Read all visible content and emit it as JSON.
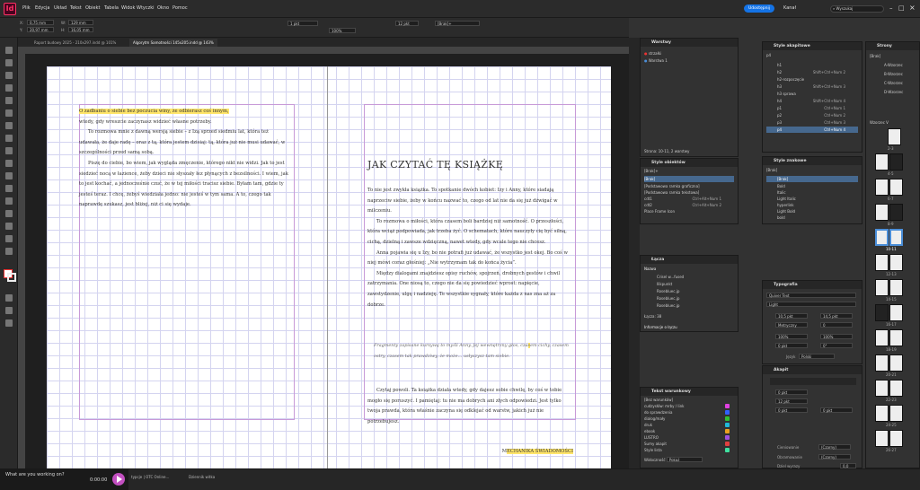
{
  "app": {
    "logo": "Id",
    "menu": [
      "Plik",
      "Edycja",
      "Układ",
      "Tekst",
      "Obiekt",
      "Tabela",
      "Widok",
      "Wtyczki",
      "Okno",
      "Pomoc"
    ],
    "share_button": "Udostępnij",
    "search_placeholder": "Wyszukaj"
  },
  "control": {
    "x": "0,75 mm",
    "y": "20,97 mm",
    "w": "129 mm",
    "h": "16,05 mm",
    "stroke_weight": "1 pkt",
    "zoom": "100%",
    "ref_pt": "12 pkt",
    "style": "[Brak]+"
  },
  "doc_tabs": [
    "Raport budowy 2025 - 210x297.indd @ 101%",
    "Algorytm Samotności 145x205.indd @ 143%"
  ],
  "page": {
    "left_paragraphs": [
      {
        "pre": "",
        "hl": "O zadbaniu o siebie bez poczucia winy, ze odbierasz coś innym,",
        "post": ""
      },
      {
        "pre": "wtedy, gdy wreszcie zaczynasz widzieć własne potrzeby.",
        "hl": "",
        "post": ""
      },
      {
        "pre": "To rozmowa mnie z dawną wersją siebie – z Izą sprzed siedmiu lat, która też udawała, że daje radę – oraz z tą, która jestem dzisiaj: tą, która już nie musi udawać, w szczególności przed samą sobą.",
        "hl": "",
        "post": ""
      },
      {
        "pre": "Piszę do ciebie, bo wiem, jak wygląda zmęczenie, którego nikt nie widzi. Jak to jest siedzieć nocą w łazience, żeby dzieci nie słyszały łez płynących z bezsilności. I wiem, jak to jest kochać, a jednocześnie czuć, że w tej miłości tracisz siebie. Byłam tam, gdzie ty jesteś teraz. I chcę, żebyś wiedziała jedno: nie jesteś w tym sama. A to, czego tak naprawdę szukasz, jest bliżej, niż ci się wydaje.",
        "hl": "",
        "post": ""
      }
    ],
    "chapter_title": "JAK CZYTAĆ TĘ KSIĄŻKĘ",
    "right_paragraphs": [
      {
        "pre": "To nie jest zwykła książka. To spotkanie dwóch kobiet: Izy i Anny, które siadają naprzeciw siebie, żeby w końcu nazwać to, czego od lat nie da się już dźwigać w milczeniu.",
        "hl": "",
        "post": ""
      },
      {
        "pre": "To rozmowa o miłości, która czasem boli bardziej niż samotność. O przeszłości, która wciąż podpowiada, jak trzeba żyć. O schematach, które nauczyły cię być silną, cichą, dzielną i zawsze wdzięczną, nawet wtedy, gdy wcale tego nie chcesz.",
        "hl": "",
        "post": ""
      },
      {
        "pre": "Anna pojawia się u Izy, bo nie potraf",
        "hl": "i",
        "post": " już udawać, że wszystko jest okej. Bo coś w niej mówi coraz głośniej: „Nie wytrzymam tak do końca życia”."
      },
      {
        "pre": "Między dialogami znajdziesz opisy ruchów, spojrzeń, drobnych gestów i chwil zatrzymania. One niosą to, czego nie da się powiedzieć wprost: napięcie, zawstydzenie, ulgę i nadzieję. Te wszystkie sygnały, które każda z nas zna aż za dobrze.",
        "hl": "",
        "post": ""
      }
    ],
    "quote": {
      "pre": "Fragmenty zapisane kursywą to myśli Anny. Jej wewnętrzny głos, cza",
      "hl": "s",
      "post": "em cichy, czasem ostry, czasem tak prawdziwy, że może… usłyszysz tam siebie."
    },
    "right_paragraphs_2": [
      {
        "pre": "Czytaj powoli. Ta książka działa wtedy, gdy dajesz sobie chwilę, by coś w tobie mogło się poruszyć. I pamiętaj: tu nie ma dobrych ani złych odpowiedzi. Jest tylko twoja prawda, która właśnie zaczyna się odklejać od warstw, jakich już nie potrzebujesz.",
        "hl": "",
        "post": ""
      }
    ],
    "signature": {
      "pre": "M",
      "hl": "ECHANIKA ŚWIADOMOŚCI",
      "post": ""
    }
  },
  "panels": {
    "layers": {
      "title": "Warstwy",
      "items": [
        "strzałki",
        "Warstwa 1"
      ],
      "footer": "Strona: 10-11, 2 warstwy"
    },
    "para_styles": {
      "title": "Style akapitowe",
      "current": "p4",
      "items": [
        {
          "name": "h1",
          "shortcut": ""
        },
        {
          "name": "h2",
          "shortcut": "Shift+Ctrl+Num 2"
        },
        {
          "name": "h2-rozpoczęcie",
          "shortcut": ""
        },
        {
          "name": "h3",
          "shortcut": "Shift+Ctrl+Num 3"
        },
        {
          "name": "h3 sprawa",
          "shortcut": ""
        },
        {
          "name": "h4",
          "shortcut": "Shift+Ctrl+Num 4"
        },
        {
          "name": "p1",
          "shortcut": "Ctrl+Num 1"
        },
        {
          "name": "p2",
          "shortcut": "Ctrl+Num 2"
        },
        {
          "name": "p3",
          "shortcut": "Ctrl+Num 3"
        },
        {
          "name": "p4",
          "shortcut": "Ctrl+Num 4"
        }
      ]
    },
    "object_styles": {
      "title": "Style obiektów",
      "current": "[Brak]+",
      "items": [
        {
          "name": "[Brak]",
          "shortcut": ""
        },
        {
          "name": "[Podstawowa ramka graficzna]",
          "shortcut": ""
        },
        {
          "name": "[Podstawowa ramka tekstowa]",
          "shortcut": ""
        },
        {
          "name": "cdt1",
          "shortcut": "Ctrl+Alt+Num 1"
        },
        {
          "name": "cdt2",
          "shortcut": "Ctrl+Alt+Num 2"
        },
        {
          "name": "Place Frame Icon",
          "shortcut": ""
        }
      ]
    },
    "char_styles": {
      "title": "Style znakowe",
      "current": "[Brak]",
      "items": [
        "[Brak]",
        "Bold",
        "Italic",
        "Light Italic",
        "hyperlink",
        "Light Bold",
        "bold"
      ]
    },
    "links": {
      "title": "Łącza",
      "col": "Nazwa",
      "items": [
        "Crisel w...fused",
        "Ilikpunkt",
        "Rosebluec.jp",
        "Rosebluec.jp",
        "Rosebluec.jp"
      ],
      "footer": "Łącza: 38",
      "info": "Informacje o łączu"
    },
    "conditional": {
      "title": "Tekst warunkowy",
      "items": [
        {
          "name": "[Bez warunków]",
          "color": "#323232"
        },
        {
          "name": "cudzysłów: mrby / link",
          "color": "#e040e0"
        },
        {
          "name": "do sprawdzenia",
          "color": "#3060ff"
        },
        {
          "name": "dialog/mały",
          "color": "#30c030"
        },
        {
          "name": "druk",
          "color": "#20b8d8"
        },
        {
          "name": "ebook",
          "color": "#e8a020"
        },
        {
          "name": "LUSTRO",
          "color": "#a050e0"
        },
        {
          "name": "Sumy akapit",
          "color": "#e04040"
        },
        {
          "name": "Style lista",
          "color": "#40e0a0"
        }
      ],
      "visibility_label": "Widoczność",
      "visibility_value": "Pokaż"
    },
    "pages": {
      "title": "Strony",
      "masters": [
        "[Brak]",
        "A-Wzorzec",
        "B-Wzorzec",
        "C-Wzorzec",
        "D-Wzorzec"
      ],
      "master_label": "Wzorzec V",
      "spreads": [
        "2-3",
        "4-5",
        "6-7",
        "8-9",
        "10-11",
        "12-13",
        "14-15",
        "16-17",
        "18-19",
        "20-21",
        "22-23",
        "24-25",
        "26-27",
        "28-29"
      ]
    },
    "typography": {
      "title": "Typografia",
      "font": "Quiver Text",
      "weight": "Light",
      "size": "10,5 pkt",
      "leading": "14,5 pkt",
      "kerning": "Metryczny",
      "tracking": "0",
      "vscale": "100%",
      "hscale": "100%",
      "baseline": "0 pkt",
      "skew": "0°",
      "lang_label": "Język",
      "lang": "Polski"
    },
    "paragraph": {
      "title": "Akapit",
      "left_indent": "0 pkt",
      "first_indent": "12 pkt",
      "space_before": "0 pkt",
      "space_after": "0 pkt",
      "shading_label": "Cieniowanie",
      "border_label": "Obramowanie",
      "shading_color": "(Czarny)",
      "border_color": "(Czarny)",
      "dropcap_label": "Dziel wyrazy",
      "dropcap_value": "0,0"
    }
  },
  "status": {
    "notif_text": "What are you working on?",
    "timer": "0:00:00",
    "tabs": [
      "typcje | OTC Online...",
      "Dziennik witka"
    ]
  }
}
